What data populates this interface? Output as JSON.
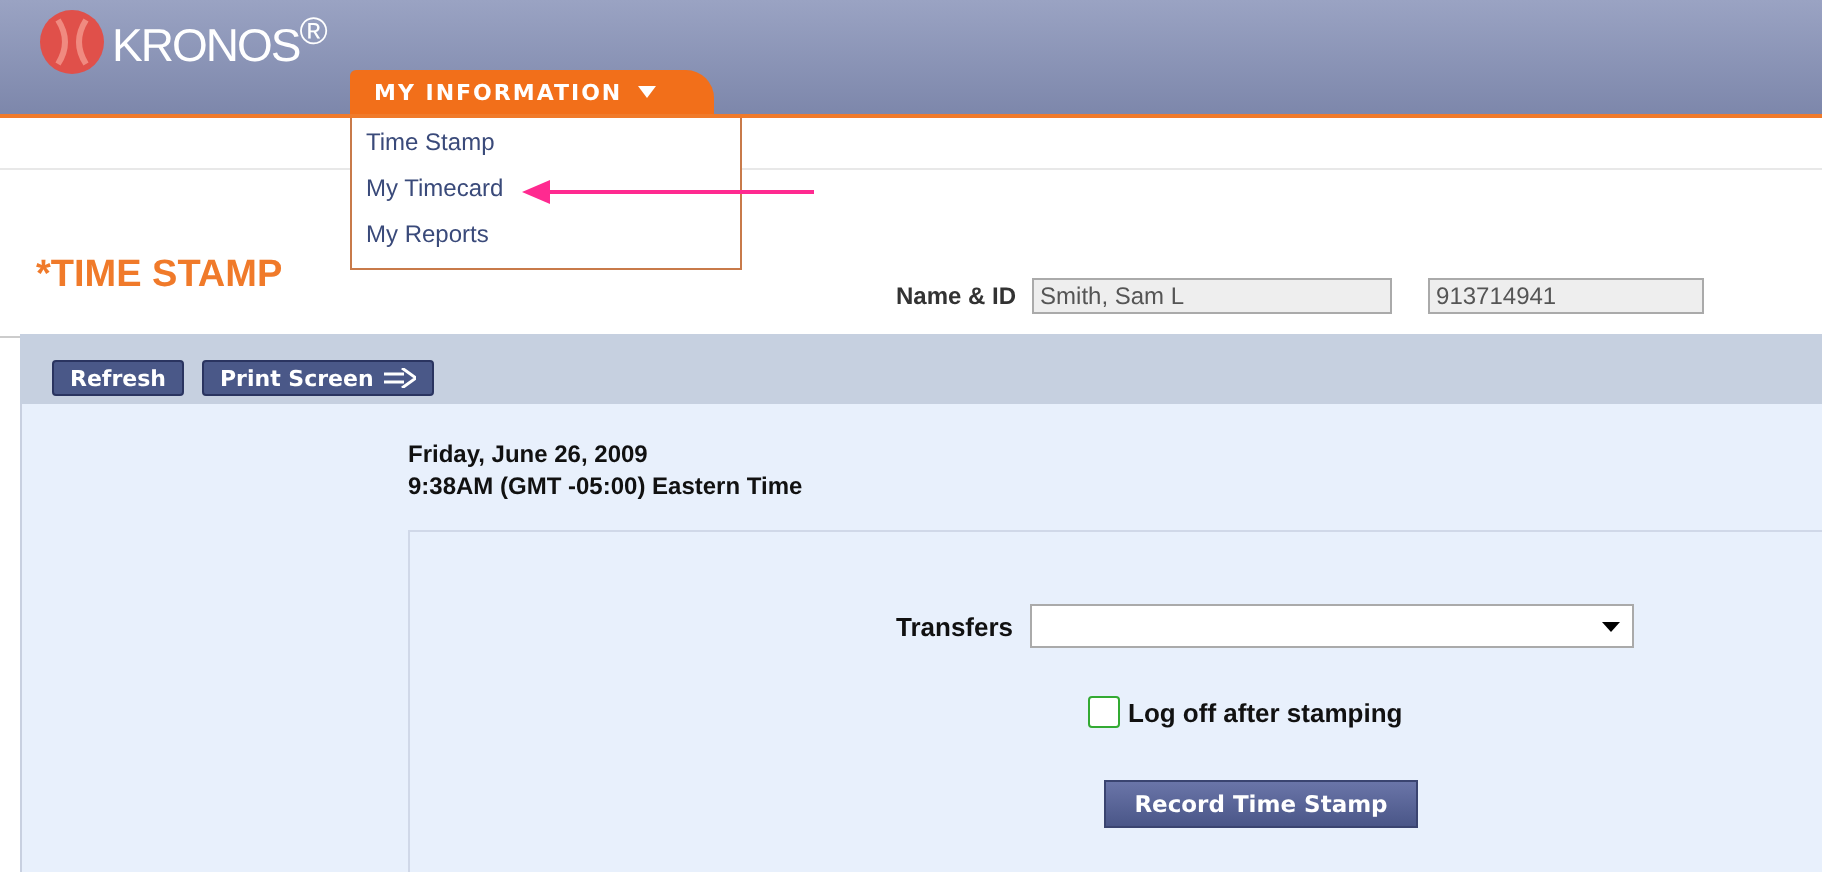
{
  "header": {
    "logo": "KRONOS$^{®}$",
    "menu_tab": {
      "label": "MY INFORMATION",
      "expanded": true
    }
  },
  "menu_items": [
    {
      "label": "Time Stamp"
    },
    {
      "label": "My Timecard"
    },
    {
      "label": "My Reports"
    }
  ],
  "page_title": "*TIME STAMP",
  "employee": {
    "label": "Name & ID",
    "name": "Smith, Sam L",
    "id": "913714941"
  },
  "toolbar": [
    {
      "label": "Refresh",
      "kind": "plain"
    },
    {
      "label": "Print Screen",
      "kind": "arrow"
    }
  ],
  "date": "Friday, June 26, 2009",
  "time": "9:38AM (GMT -05:00) Eastern Time",
  "transfers": {
    "label": "Transfers"
  },
  "log_off": {
    "label": "Log off after stamping",
    "checked": false
  },
  "record_button": "Record Time Stamp"
}
